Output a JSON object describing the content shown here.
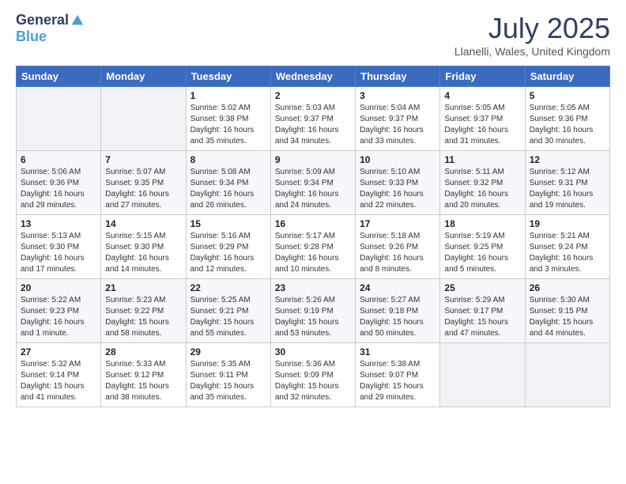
{
  "header": {
    "logo_general": "General",
    "logo_blue": "Blue",
    "title": "July 2025",
    "subtitle": "Llanelli, Wales, United Kingdom"
  },
  "days_of_week": [
    "Sunday",
    "Monday",
    "Tuesday",
    "Wednesday",
    "Thursday",
    "Friday",
    "Saturday"
  ],
  "weeks": [
    [
      {
        "day": "",
        "info": ""
      },
      {
        "day": "",
        "info": ""
      },
      {
        "day": "1",
        "info": "Sunrise: 5:02 AM\nSunset: 9:38 PM\nDaylight: 16 hours\nand 35 minutes."
      },
      {
        "day": "2",
        "info": "Sunrise: 5:03 AM\nSunset: 9:37 PM\nDaylight: 16 hours\nand 34 minutes."
      },
      {
        "day": "3",
        "info": "Sunrise: 5:04 AM\nSunset: 9:37 PM\nDaylight: 16 hours\nand 33 minutes."
      },
      {
        "day": "4",
        "info": "Sunrise: 5:05 AM\nSunset: 9:37 PM\nDaylight: 16 hours\nand 31 minutes."
      },
      {
        "day": "5",
        "info": "Sunrise: 5:05 AM\nSunset: 9:36 PM\nDaylight: 16 hours\nand 30 minutes."
      }
    ],
    [
      {
        "day": "6",
        "info": "Sunrise: 5:06 AM\nSunset: 9:36 PM\nDaylight: 16 hours\nand 29 minutes."
      },
      {
        "day": "7",
        "info": "Sunrise: 5:07 AM\nSunset: 9:35 PM\nDaylight: 16 hours\nand 27 minutes."
      },
      {
        "day": "8",
        "info": "Sunrise: 5:08 AM\nSunset: 9:34 PM\nDaylight: 16 hours\nand 26 minutes."
      },
      {
        "day": "9",
        "info": "Sunrise: 5:09 AM\nSunset: 9:34 PM\nDaylight: 16 hours\nand 24 minutes."
      },
      {
        "day": "10",
        "info": "Sunrise: 5:10 AM\nSunset: 9:33 PM\nDaylight: 16 hours\nand 22 minutes."
      },
      {
        "day": "11",
        "info": "Sunrise: 5:11 AM\nSunset: 9:32 PM\nDaylight: 16 hours\nand 20 minutes."
      },
      {
        "day": "12",
        "info": "Sunrise: 5:12 AM\nSunset: 9:31 PM\nDaylight: 16 hours\nand 19 minutes."
      }
    ],
    [
      {
        "day": "13",
        "info": "Sunrise: 5:13 AM\nSunset: 9:30 PM\nDaylight: 16 hours\nand 17 minutes."
      },
      {
        "day": "14",
        "info": "Sunrise: 5:15 AM\nSunset: 9:30 PM\nDaylight: 16 hours\nand 14 minutes."
      },
      {
        "day": "15",
        "info": "Sunrise: 5:16 AM\nSunset: 9:29 PM\nDaylight: 16 hours\nand 12 minutes."
      },
      {
        "day": "16",
        "info": "Sunrise: 5:17 AM\nSunset: 9:28 PM\nDaylight: 16 hours\nand 10 minutes."
      },
      {
        "day": "17",
        "info": "Sunrise: 5:18 AM\nSunset: 9:26 PM\nDaylight: 16 hours\nand 8 minutes."
      },
      {
        "day": "18",
        "info": "Sunrise: 5:19 AM\nSunset: 9:25 PM\nDaylight: 16 hours\nand 5 minutes."
      },
      {
        "day": "19",
        "info": "Sunrise: 5:21 AM\nSunset: 9:24 PM\nDaylight: 16 hours\nand 3 minutes."
      }
    ],
    [
      {
        "day": "20",
        "info": "Sunrise: 5:22 AM\nSunset: 9:23 PM\nDaylight: 16 hours\nand 1 minute."
      },
      {
        "day": "21",
        "info": "Sunrise: 5:23 AM\nSunset: 9:22 PM\nDaylight: 15 hours\nand 58 minutes."
      },
      {
        "day": "22",
        "info": "Sunrise: 5:25 AM\nSunset: 9:21 PM\nDaylight: 15 hours\nand 55 minutes."
      },
      {
        "day": "23",
        "info": "Sunrise: 5:26 AM\nSunset: 9:19 PM\nDaylight: 15 hours\nand 53 minutes."
      },
      {
        "day": "24",
        "info": "Sunrise: 5:27 AM\nSunset: 9:18 PM\nDaylight: 15 hours\nand 50 minutes."
      },
      {
        "day": "25",
        "info": "Sunrise: 5:29 AM\nSunset: 9:17 PM\nDaylight: 15 hours\nand 47 minutes."
      },
      {
        "day": "26",
        "info": "Sunrise: 5:30 AM\nSunset: 9:15 PM\nDaylight: 15 hours\nand 44 minutes."
      }
    ],
    [
      {
        "day": "27",
        "info": "Sunrise: 5:32 AM\nSunset: 9:14 PM\nDaylight: 15 hours\nand 41 minutes."
      },
      {
        "day": "28",
        "info": "Sunrise: 5:33 AM\nSunset: 9:12 PM\nDaylight: 15 hours\nand 38 minutes."
      },
      {
        "day": "29",
        "info": "Sunrise: 5:35 AM\nSunset: 9:11 PM\nDaylight: 15 hours\nand 35 minutes."
      },
      {
        "day": "30",
        "info": "Sunrise: 5:36 AM\nSunset: 9:09 PM\nDaylight: 15 hours\nand 32 minutes."
      },
      {
        "day": "31",
        "info": "Sunrise: 5:38 AM\nSunset: 9:07 PM\nDaylight: 15 hours\nand 29 minutes."
      },
      {
        "day": "",
        "info": ""
      },
      {
        "day": "",
        "info": ""
      }
    ]
  ]
}
